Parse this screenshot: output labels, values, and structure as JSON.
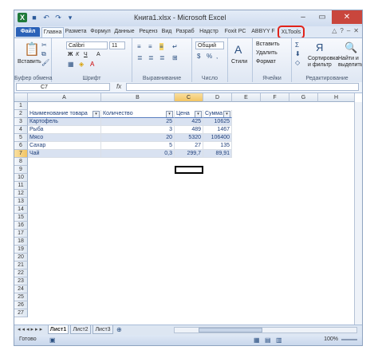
{
  "window": {
    "title": "Книга1.xlsx - Microsoft Excel",
    "logo": "X",
    "quick_access_icons": [
      "save-icon",
      "undo-icon",
      "redo-icon",
      "dropdown-icon"
    ],
    "controls": {
      "minimize": "–",
      "restore": "▭",
      "close": "✕"
    }
  },
  "tabs": [
    "Файл",
    "Главна",
    "Размета",
    "Формул",
    "Данные",
    "Реценз",
    "Вид",
    "Разраб",
    "Надстр",
    "Foxit PC",
    "ABBYY F",
    "XLTools"
  ],
  "tab_active": "Главна",
  "tab_highlight_color": "#e2231a",
  "ribbon": {
    "clipboard": {
      "paste_label": "Вставить",
      "group": "Буфер обмена"
    },
    "font": {
      "name": "Calibri",
      "size": "11",
      "bold": "Ж",
      "italic": "К",
      "underline": "Ч",
      "grow": "A",
      "group": "Шрифт"
    },
    "alignment": {
      "group": "Выравнивание"
    },
    "number": {
      "format": "Общий",
      "group": "Число"
    },
    "styles": {
      "label": "Стили"
    },
    "cells": {
      "insert": "Вставить",
      "delete": "Удалить",
      "format": "Формат",
      "group": "Ячейки"
    },
    "editing": {
      "sort": "Сортировка и фильтр",
      "find": "Найти и выделить",
      "group": "Редактирование"
    }
  },
  "formula_bar": {
    "name_box": "C7",
    "fx": "fx",
    "value": ""
  },
  "columns": [
    "A",
    "B",
    "C",
    "D",
    "E",
    "F",
    "G",
    "H"
  ],
  "selected_column": "C",
  "rows": [
    "1",
    "2",
    "3",
    "4",
    "5",
    "6",
    "7",
    "8",
    "9",
    "10",
    "11",
    "12",
    "13",
    "14",
    "15",
    "16",
    "17",
    "18",
    "19",
    "20",
    "21",
    "22",
    "23",
    "24",
    "25",
    "26",
    "27"
  ],
  "selected_row": "7",
  "table": {
    "headers": [
      "Наименование товара",
      "Количество",
      "Цена",
      "Сумма"
    ],
    "rows": [
      [
        "Картофель",
        "25",
        "425",
        "10625"
      ],
      [
        "Рыба",
        "3",
        "489",
        "1467"
      ],
      [
        "Мясо",
        "20",
        "5320",
        "106400"
      ],
      [
        "Сахар",
        "5",
        "27",
        "135"
      ],
      [
        "Чай",
        "0,3",
        "299,7",
        "89,91"
      ]
    ]
  },
  "sheets": [
    "Лист1",
    "Лист2",
    "Лист3"
  ],
  "active_sheet": "Лист1",
  "status": {
    "ready": "Готово",
    "zoom": "100%"
  }
}
